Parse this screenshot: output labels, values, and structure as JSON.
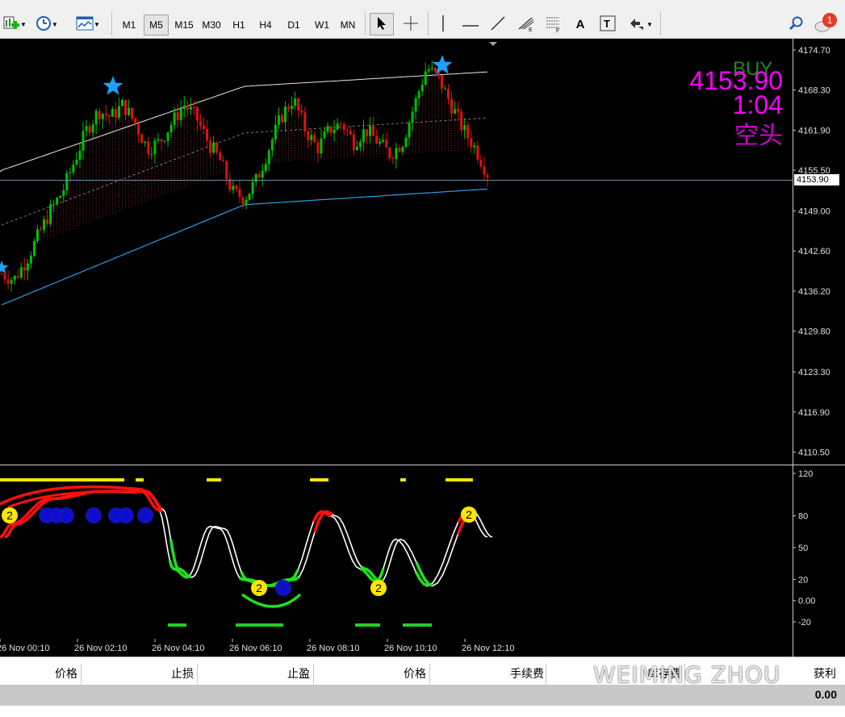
{
  "toolbar": {
    "timeframes": [
      {
        "label": "M1",
        "active": false
      },
      {
        "label": "M5",
        "active": true
      },
      {
        "label": "M15",
        "active": false
      },
      {
        "label": "M30",
        "active": false
      },
      {
        "label": "H1",
        "active": false
      },
      {
        "label": "H4",
        "active": false
      },
      {
        "label": "D1",
        "active": false
      },
      {
        "label": "W1",
        "active": false
      },
      {
        "label": "MN",
        "active": false
      }
    ],
    "text_tool_label": "A",
    "notification_count": "1",
    "icons": [
      "new-chart-icon",
      "clock-icon",
      "template-icon",
      "cursor-icon",
      "crosshair-icon",
      "vertical-line-icon",
      "horizontal-line-icon",
      "trendline-icon",
      "fibonacci-icon",
      "channel-icon",
      "text-icon",
      "text-label-icon",
      "arrows-icon",
      "search-icon",
      "notification-icon"
    ]
  },
  "chart": {
    "signal": "BUY",
    "price_display": "4153.90",
    "timer": "1:04",
    "direction": "空头",
    "current_price_tag": "4153.90",
    "colors": {
      "signal": "#1a8a1a",
      "price": "#ff00ff",
      "direction": "#cc00cc",
      "bull": "#00c000",
      "bear": "#e01010",
      "star": "#1ea0ff"
    }
  },
  "chart_data": {
    "type": "candlestick",
    "symbol_timeframe": "M5",
    "y_ticks": [
      4174.7,
      4168.3,
      4161.9,
      4155.5,
      4149.0,
      4142.6,
      4136.2,
      4129.8,
      4123.3,
      4116.9,
      4110.5
    ],
    "y_range": [
      4108.5,
      4176.5
    ],
    "current_price": 4153.9,
    "x_ticks": [
      "26 Nov 00:10",
      "26 Nov 02:10",
      "26 Nov 04:10",
      "26 Nov 06:10",
      "26 Nov 08:10",
      "26 Nov 10:10",
      "26 Nov 12:10"
    ],
    "close_path": [
      4139,
      4138,
      4141,
      4145,
      4149,
      4152,
      4157,
      4162,
      4165,
      4164,
      4166,
      4163,
      4159,
      4160,
      4163,
      4166,
      4164,
      4160,
      4157,
      4152,
      4151,
      4154,
      4159,
      4164,
      4167,
      4162,
      4159,
      4162,
      4163,
      4160,
      4162,
      4160,
      4158,
      4160,
      4166,
      4172,
      4170,
      4166,
      4162,
      4159,
      4155
    ],
    "upper_ma": [
      4155.5,
      4168.9,
      4171.2
    ],
    "lower_ma": [
      4134.0,
      4150.0,
      4152.5
    ],
    "ind_y_ticks": [
      120,
      80,
      50,
      20,
      "0.00",
      -20
    ],
    "ind_labels": [
      "2",
      "3",
      "3",
      "3",
      "3",
      "3",
      "3",
      "3",
      "2",
      "3",
      "2",
      "2"
    ]
  },
  "bottom_panel": {
    "columns": [
      "价格",
      "止损",
      "止盈",
      "价格",
      "手续费",
      "库存费",
      "获利"
    ],
    "total_profit": "0.00"
  },
  "watermark": "WEIMING ZHOU"
}
